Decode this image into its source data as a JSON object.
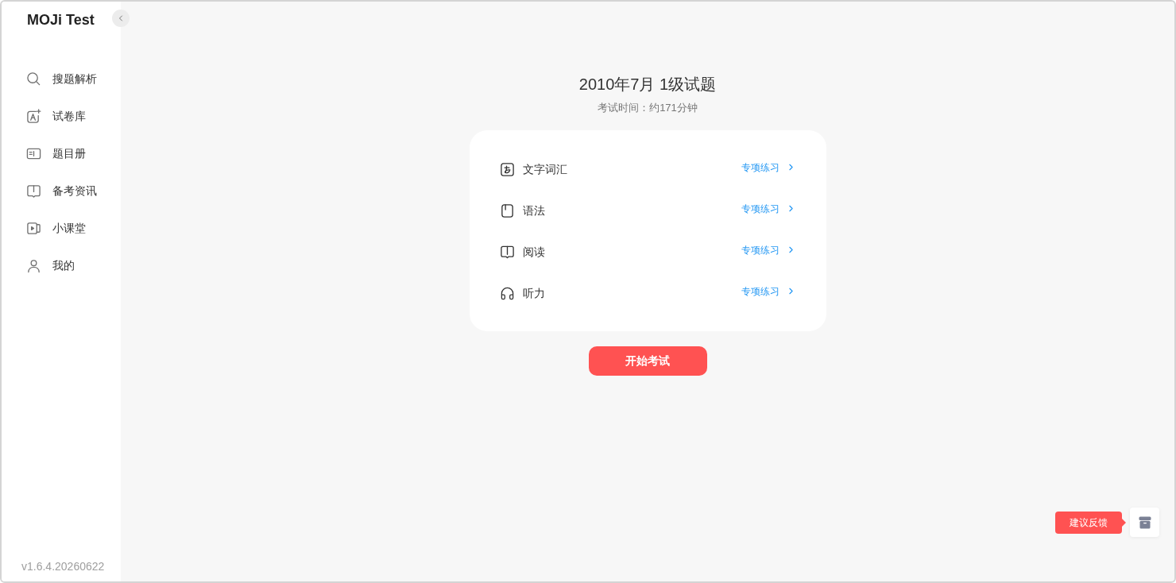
{
  "app": {
    "title": "MOJi Test",
    "version": "v1.6.4.20260622"
  },
  "sidebar": {
    "items": [
      {
        "label": "搜题解析"
      },
      {
        "label": "试卷库"
      },
      {
        "label": "题目册"
      },
      {
        "label": "备考资讯"
      },
      {
        "label": "小课堂"
      },
      {
        "label": "我的"
      }
    ]
  },
  "exam": {
    "title": "2010年7月 1级试题",
    "duration": "考试时间：约171分钟",
    "sections": [
      {
        "label": "文字词汇",
        "action": "专项练习"
      },
      {
        "label": "语法",
        "action": "专项练习"
      },
      {
        "label": "阅读",
        "action": "专项练习"
      },
      {
        "label": "听力",
        "action": "专项练习"
      }
    ],
    "start_button": "开始考试"
  },
  "feedback": {
    "tooltip": "建议反馈"
  }
}
